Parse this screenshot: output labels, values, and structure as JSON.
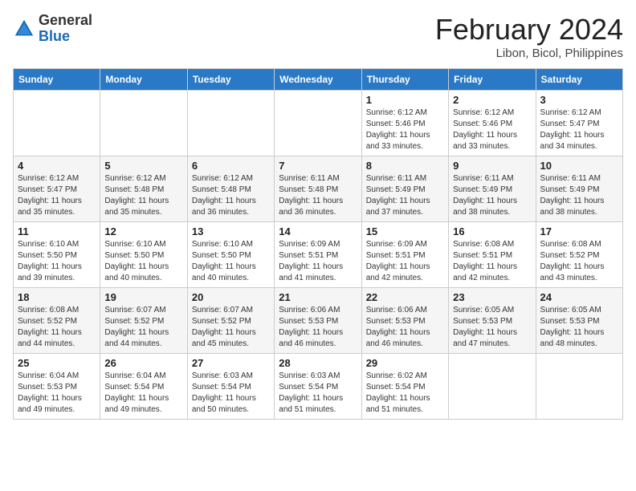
{
  "header": {
    "logo_general": "General",
    "logo_blue": "Blue",
    "month_year": "February 2024",
    "location": "Libon, Bicol, Philippines"
  },
  "weekdays": [
    "Sunday",
    "Monday",
    "Tuesday",
    "Wednesday",
    "Thursday",
    "Friday",
    "Saturday"
  ],
  "weeks": [
    [
      {
        "day": "",
        "info": ""
      },
      {
        "day": "",
        "info": ""
      },
      {
        "day": "",
        "info": ""
      },
      {
        "day": "",
        "info": ""
      },
      {
        "day": "1",
        "info": "Sunrise: 6:12 AM\nSunset: 5:46 PM\nDaylight: 11 hours and 33 minutes."
      },
      {
        "day": "2",
        "info": "Sunrise: 6:12 AM\nSunset: 5:46 PM\nDaylight: 11 hours and 33 minutes."
      },
      {
        "day": "3",
        "info": "Sunrise: 6:12 AM\nSunset: 5:47 PM\nDaylight: 11 hours and 34 minutes."
      }
    ],
    [
      {
        "day": "4",
        "info": "Sunrise: 6:12 AM\nSunset: 5:47 PM\nDaylight: 11 hours and 35 minutes."
      },
      {
        "day": "5",
        "info": "Sunrise: 6:12 AM\nSunset: 5:48 PM\nDaylight: 11 hours and 35 minutes."
      },
      {
        "day": "6",
        "info": "Sunrise: 6:12 AM\nSunset: 5:48 PM\nDaylight: 11 hours and 36 minutes."
      },
      {
        "day": "7",
        "info": "Sunrise: 6:11 AM\nSunset: 5:48 PM\nDaylight: 11 hours and 36 minutes."
      },
      {
        "day": "8",
        "info": "Sunrise: 6:11 AM\nSunset: 5:49 PM\nDaylight: 11 hours and 37 minutes."
      },
      {
        "day": "9",
        "info": "Sunrise: 6:11 AM\nSunset: 5:49 PM\nDaylight: 11 hours and 38 minutes."
      },
      {
        "day": "10",
        "info": "Sunrise: 6:11 AM\nSunset: 5:49 PM\nDaylight: 11 hours and 38 minutes."
      }
    ],
    [
      {
        "day": "11",
        "info": "Sunrise: 6:10 AM\nSunset: 5:50 PM\nDaylight: 11 hours and 39 minutes."
      },
      {
        "day": "12",
        "info": "Sunrise: 6:10 AM\nSunset: 5:50 PM\nDaylight: 11 hours and 40 minutes."
      },
      {
        "day": "13",
        "info": "Sunrise: 6:10 AM\nSunset: 5:50 PM\nDaylight: 11 hours and 40 minutes."
      },
      {
        "day": "14",
        "info": "Sunrise: 6:09 AM\nSunset: 5:51 PM\nDaylight: 11 hours and 41 minutes."
      },
      {
        "day": "15",
        "info": "Sunrise: 6:09 AM\nSunset: 5:51 PM\nDaylight: 11 hours and 42 minutes."
      },
      {
        "day": "16",
        "info": "Sunrise: 6:08 AM\nSunset: 5:51 PM\nDaylight: 11 hours and 42 minutes."
      },
      {
        "day": "17",
        "info": "Sunrise: 6:08 AM\nSunset: 5:52 PM\nDaylight: 11 hours and 43 minutes."
      }
    ],
    [
      {
        "day": "18",
        "info": "Sunrise: 6:08 AM\nSunset: 5:52 PM\nDaylight: 11 hours and 44 minutes."
      },
      {
        "day": "19",
        "info": "Sunrise: 6:07 AM\nSunset: 5:52 PM\nDaylight: 11 hours and 44 minutes."
      },
      {
        "day": "20",
        "info": "Sunrise: 6:07 AM\nSunset: 5:52 PM\nDaylight: 11 hours and 45 minutes."
      },
      {
        "day": "21",
        "info": "Sunrise: 6:06 AM\nSunset: 5:53 PM\nDaylight: 11 hours and 46 minutes."
      },
      {
        "day": "22",
        "info": "Sunrise: 6:06 AM\nSunset: 5:53 PM\nDaylight: 11 hours and 46 minutes."
      },
      {
        "day": "23",
        "info": "Sunrise: 6:05 AM\nSunset: 5:53 PM\nDaylight: 11 hours and 47 minutes."
      },
      {
        "day": "24",
        "info": "Sunrise: 6:05 AM\nSunset: 5:53 PM\nDaylight: 11 hours and 48 minutes."
      }
    ],
    [
      {
        "day": "25",
        "info": "Sunrise: 6:04 AM\nSunset: 5:53 PM\nDaylight: 11 hours and 49 minutes."
      },
      {
        "day": "26",
        "info": "Sunrise: 6:04 AM\nSunset: 5:54 PM\nDaylight: 11 hours and 49 minutes."
      },
      {
        "day": "27",
        "info": "Sunrise: 6:03 AM\nSunset: 5:54 PM\nDaylight: 11 hours and 50 minutes."
      },
      {
        "day": "28",
        "info": "Sunrise: 6:03 AM\nSunset: 5:54 PM\nDaylight: 11 hours and 51 minutes."
      },
      {
        "day": "29",
        "info": "Sunrise: 6:02 AM\nSunset: 5:54 PM\nDaylight: 11 hours and 51 minutes."
      },
      {
        "day": "",
        "info": ""
      },
      {
        "day": "",
        "info": ""
      }
    ]
  ]
}
